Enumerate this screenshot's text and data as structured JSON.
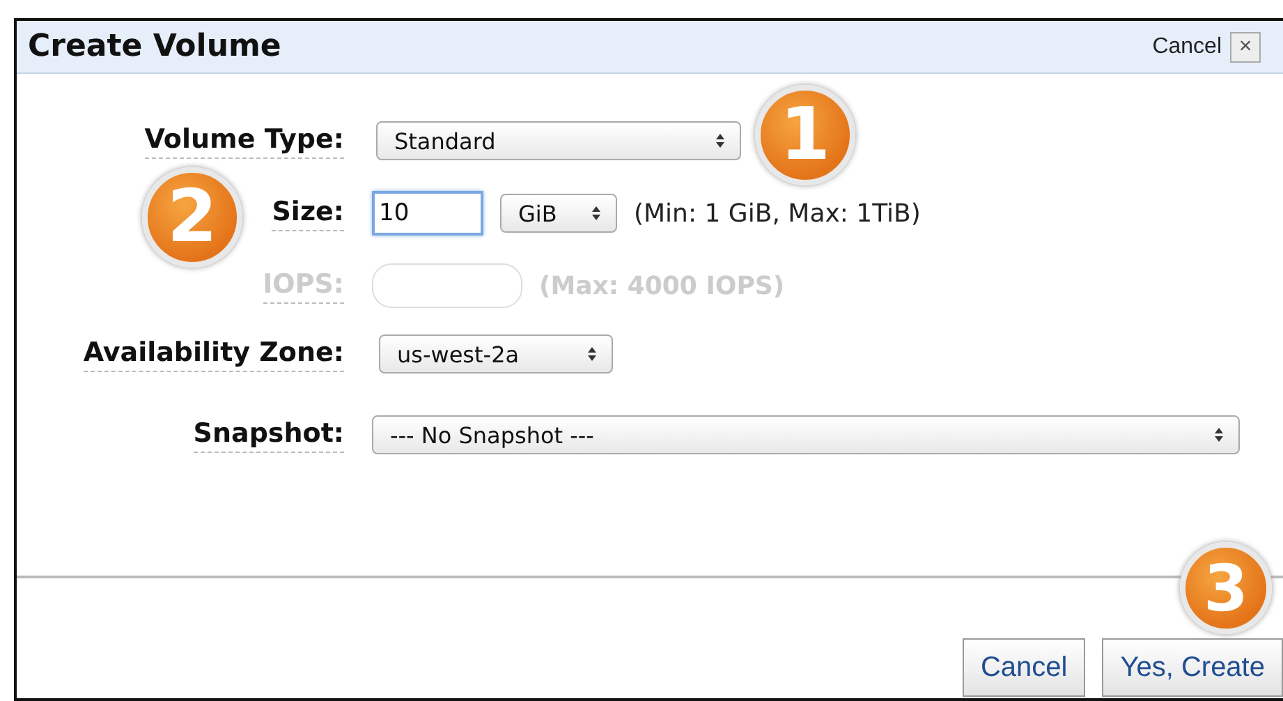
{
  "dialog": {
    "title": "Create Volume",
    "header_cancel": "Cancel",
    "close": "×"
  },
  "fields": [
    {
      "label": "Volume Type:",
      "disabled": false,
      "control": {
        "kind": "select",
        "value": "Standard"
      }
    },
    {
      "label": "Size:",
      "disabled": false,
      "control": {
        "kind": "input",
        "value": "10",
        "focused": true
      },
      "unit": {
        "kind": "select",
        "value": "GiB"
      },
      "hint": "(Min: 1 GiB, Max: 1TiB)"
    },
    {
      "label": "IOPS:",
      "disabled": true,
      "control": {
        "kind": "input"
      },
      "hint": "(Max: 4000 IOPS)"
    },
    {
      "label": "Availability Zone:",
      "disabled": false,
      "control": {
        "kind": "select",
        "value": "us-west-2a"
      }
    },
    {
      "label": "Snapshot:",
      "disabled": false,
      "control": {
        "kind": "select",
        "value": "--- No Snapshot ---"
      }
    }
  ],
  "buttons": [
    {
      "label": "Cancel"
    },
    {
      "label": "Yes, Create"
    }
  ],
  "badges": [
    "1",
    "2",
    "3"
  ]
}
